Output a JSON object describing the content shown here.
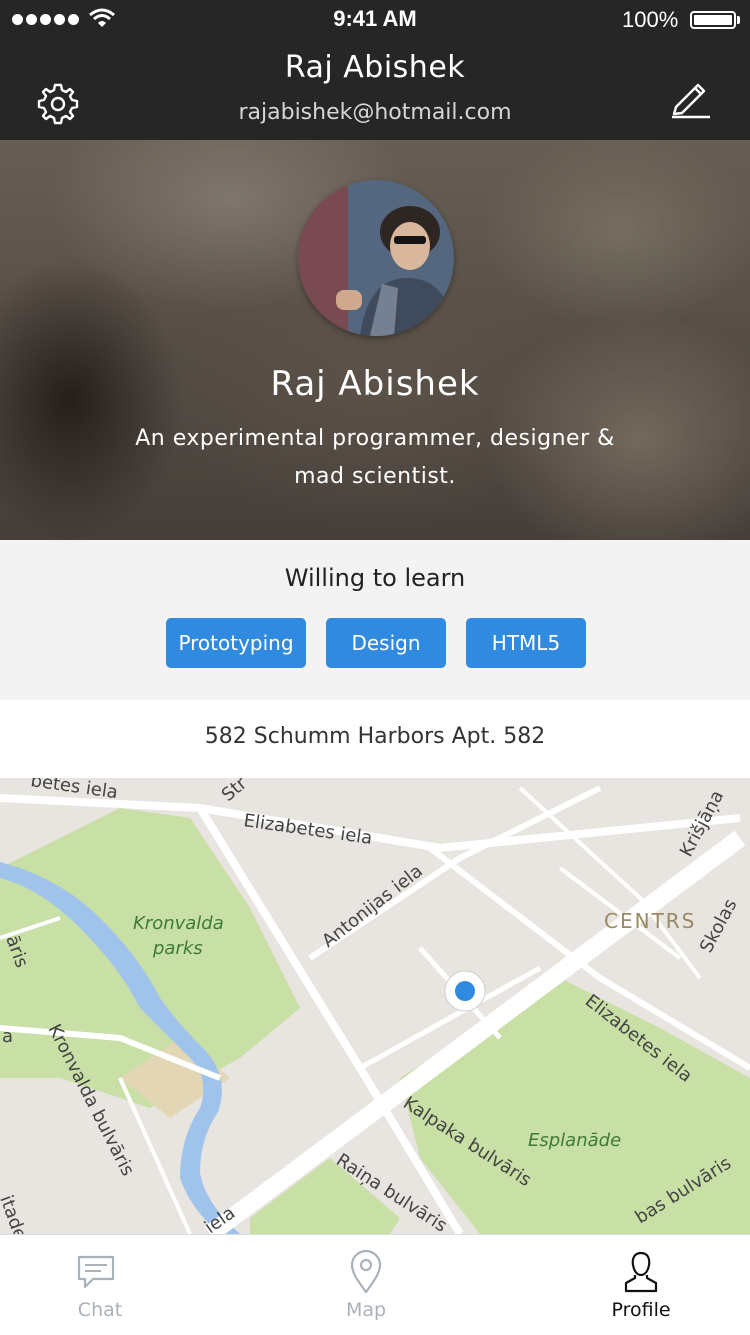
{
  "status": {
    "time": "9:41 AM",
    "battery": "100%"
  },
  "nav": {
    "title": "Raj Abishek",
    "subtitle": "rajabishek@hotmail.com"
  },
  "profile": {
    "name": "Raj Abishek",
    "bio": "An experimental programmer, designer & mad scientist."
  },
  "skills": {
    "title": "Willing to learn",
    "items": [
      "Prototyping",
      "Design",
      "HTML5"
    ]
  },
  "address": "582 Schumm Harbors Apt. 582",
  "map": {
    "labels": {
      "kronvalda": "Kronvalda",
      "parks": "parks",
      "elizabetes1": "Elizabetes iela",
      "elizabetes2": "Elizabetes iela",
      "antonijas": "Antonijas iela",
      "centrs": "CENTRS",
      "kalpaka": "Kalpaka bulvāris",
      "raina": "Raiņa bulvāris",
      "kronvalda_bulv": "Kronvalda bulvāris",
      "esplanade": "Esplanāde",
      "krisjana": "Krišjāņa",
      "skolas": "Skolas",
      "betes": "betes iela",
      "str": "Str",
      "aris": "āris",
      "iela": "iela",
      "bas": "bas bulvāris",
      "itadel": "itadel",
      "a": "a"
    }
  },
  "tabs": [
    {
      "label": "Chat",
      "icon": "chat-icon",
      "active": false
    },
    {
      "label": "Map",
      "icon": "map-pin-icon",
      "active": false
    },
    {
      "label": "Profile",
      "icon": "profile-icon",
      "active": true
    }
  ],
  "colors": {
    "accent": "#2f8ae0",
    "topbar": "#262626",
    "park": "#c8dfa6",
    "water": "#9fc3eb",
    "road": "#ffffff",
    "tab_inactive": "#a9b1b9"
  }
}
